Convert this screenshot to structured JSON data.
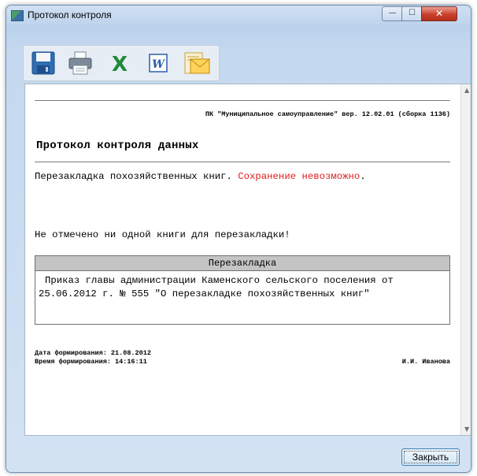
{
  "window": {
    "title": "Протокол контроля",
    "controls": {
      "minimize": "—",
      "maximize": "☐",
      "close": "✕"
    }
  },
  "toolbar": {
    "buttons": [
      {
        "icon": "save-icon"
      },
      {
        "icon": "print-icon"
      },
      {
        "icon": "excel-icon",
        "glyph": "X"
      },
      {
        "icon": "word-icon",
        "glyph": "W"
      },
      {
        "icon": "email-icon"
      }
    ]
  },
  "report": {
    "header_line": "ПК \"Муниципальное самоуправление\" вер. 12.02.01 (сборка 1136)",
    "title": "Протокол контроля данных",
    "line1_prefix": "Перезакладка похозяйственных книг. ",
    "line1_error": "Сохранение невозможно",
    "line1_suffix": ".",
    "line2": "Не отмечено ни одной книги для перезакладки!",
    "box": {
      "header": "Перезакладка",
      "body": "Приказ главы администрации Каменского сельского поселения от 25.06.2012 г. № 555 \"О перезакладке похозяйственных книг\""
    },
    "date_line": "Дата формирования: 21.08.2012",
    "time_line": "Время формирования: 14:16:11",
    "signer": "И.И. Иванова"
  },
  "footer": {
    "close_label": "Закрыть"
  },
  "colors": {
    "error": "#e01b1b",
    "accent": "#3c7fb1"
  }
}
